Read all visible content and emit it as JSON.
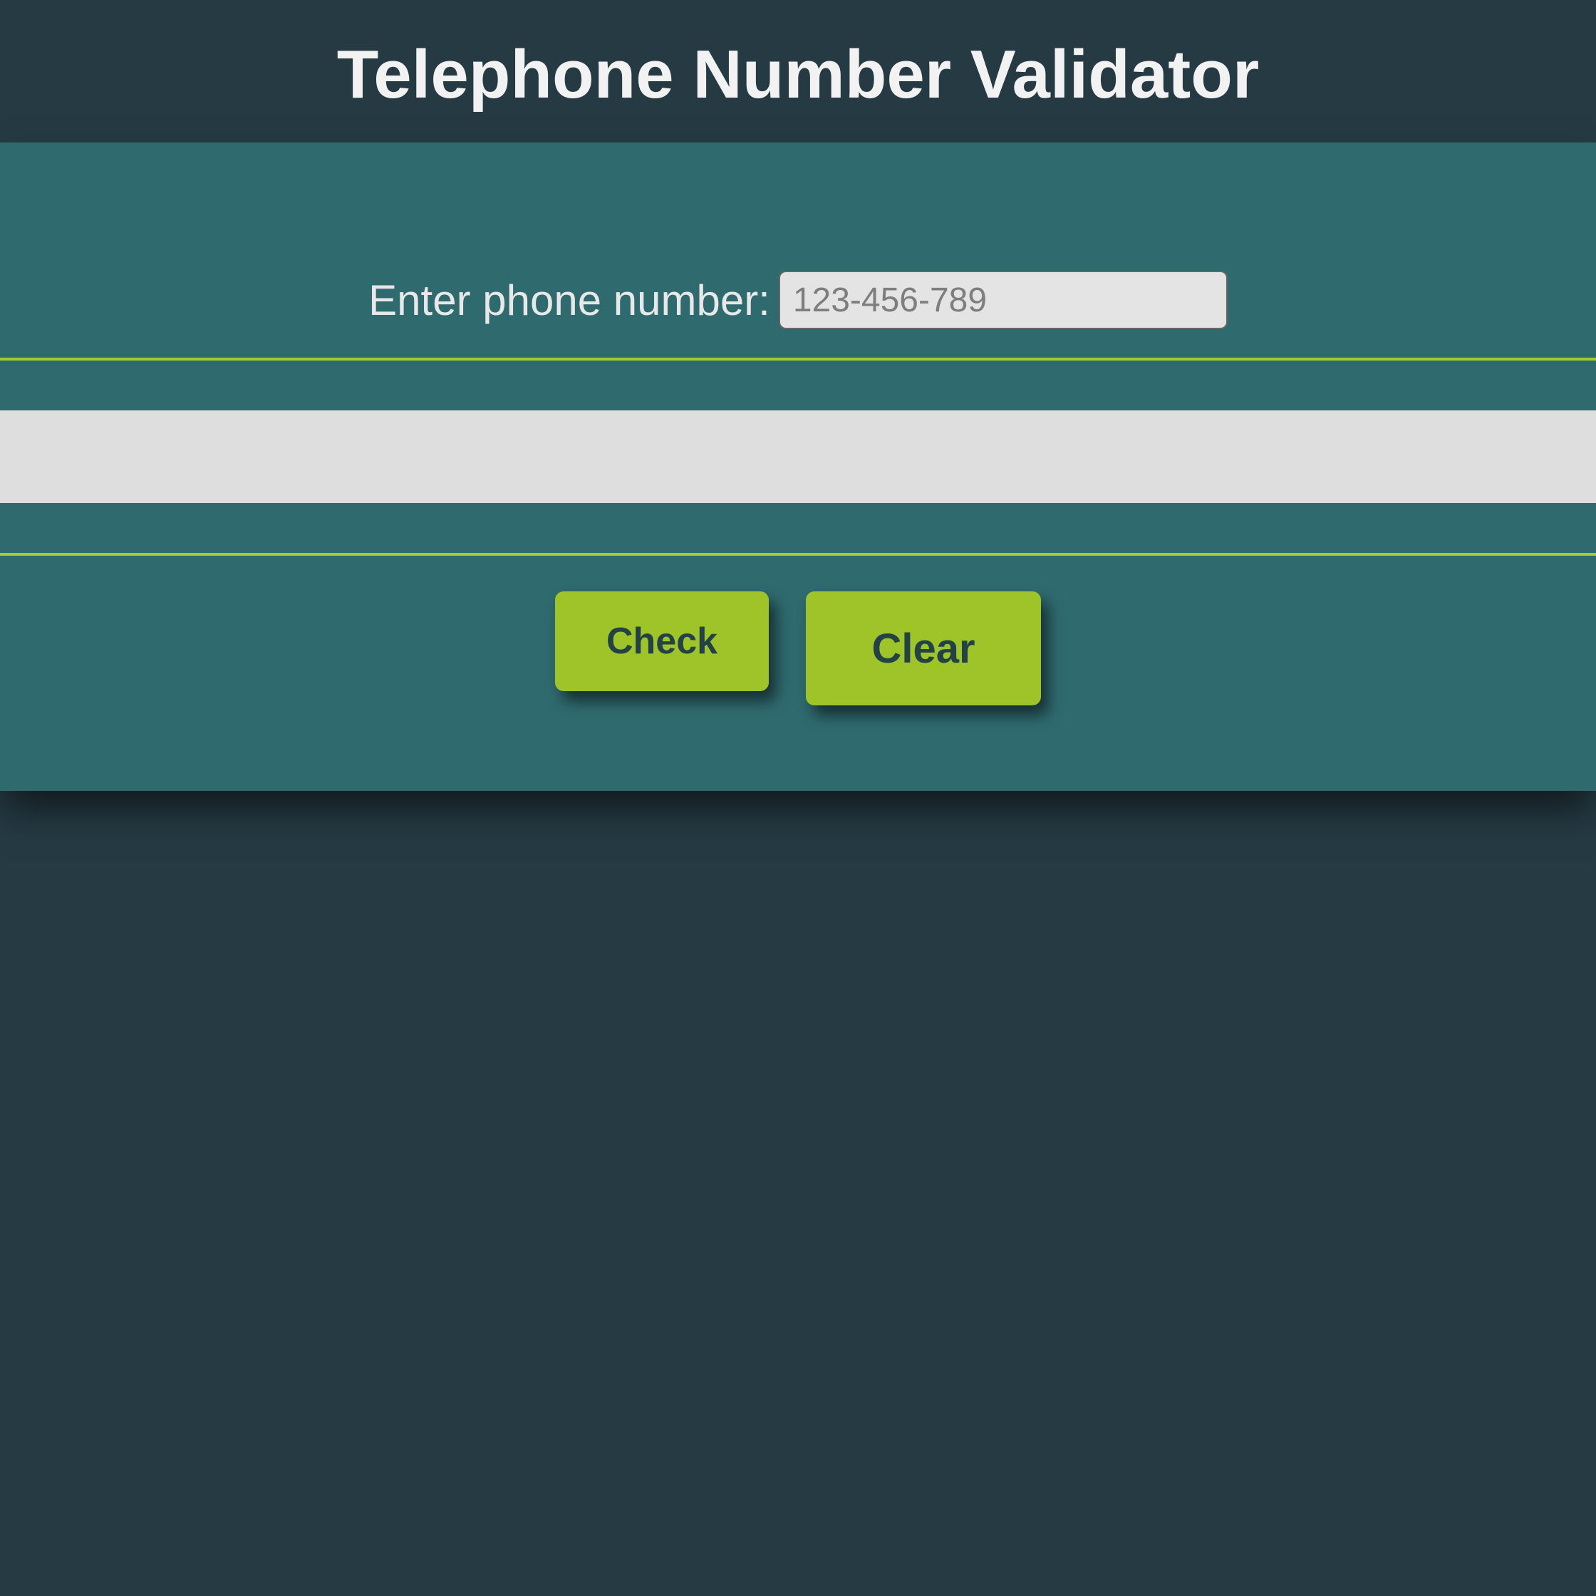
{
  "header": {
    "title": "Telephone Number Validator"
  },
  "form": {
    "label": "Enter phone number:",
    "placeholder": "123-456-789",
    "value": "",
    "result": ""
  },
  "buttons": {
    "check": "Check",
    "clear": "Clear"
  },
  "colors": {
    "page_bg": "#253a43",
    "card_bg": "#2f6a6f",
    "accent": "#a1cf27",
    "button_bg": "#9ec42a",
    "button_text": "#234247",
    "result_strip": "#dedede",
    "text_light": "#f2f2f2"
  }
}
